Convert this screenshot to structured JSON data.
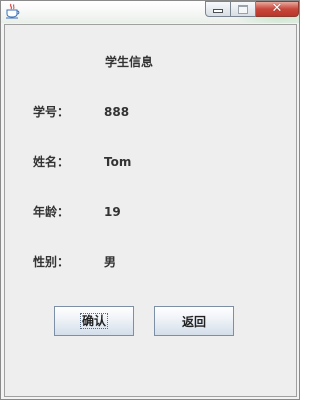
{
  "window": {
    "controls": {
      "close_glyph": "✕"
    }
  },
  "form": {
    "title": "学生信息",
    "rows": [
      {
        "label": "学号：",
        "value": "888"
      },
      {
        "label": "姓名：",
        "value": "Tom"
      },
      {
        "label": "年龄：",
        "value": "19"
      },
      {
        "label": "性别：",
        "value": "男"
      }
    ]
  },
  "buttons": {
    "confirm": "确认",
    "back": "返回"
  },
  "colors": {
    "close_button": "#c8473a",
    "panel_background": "#eeeeee",
    "text": "#333333"
  },
  "icons": {
    "app": "java-cup-icon",
    "minimize": "minimize-icon",
    "maximize": "maximize-icon",
    "close": "close-icon"
  }
}
